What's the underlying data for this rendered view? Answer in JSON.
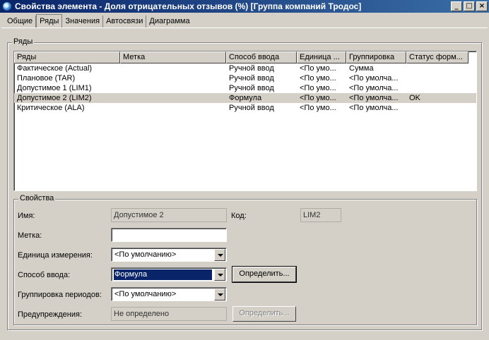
{
  "window": {
    "title": "Свойства элемента - Доля отрицательных отзывов (%) [Группа компаний Тродос]",
    "minimize": "_",
    "maximize": "□",
    "close": "×"
  },
  "tabs": [
    {
      "label": "Общие",
      "active": false
    },
    {
      "label": "Ряды",
      "active": true
    },
    {
      "label": "Значения",
      "active": false
    },
    {
      "label": "Автосвязи",
      "active": false
    },
    {
      "label": "Диаграмма",
      "active": false
    }
  ],
  "series_group": {
    "title": "Ряды",
    "columns": [
      "Ряды",
      "Метка",
      "Способ ввода",
      "Единица ...",
      "Группировка",
      "Статус форм..."
    ],
    "rows": [
      [
        "Фактическое (Actual)",
        "",
        "Ручной ввод",
        "<По умо...",
        "Сумма",
        ""
      ],
      [
        "Плановое (TAR)",
        "",
        "Ручной ввод",
        "<По умо...",
        "<По умолча...",
        ""
      ],
      [
        "Допустимое 1 (LIM1)",
        "",
        "Ручной ввод",
        "<По умо...",
        "<По умолча...",
        ""
      ],
      [
        "Допустимое 2 (LIM2)",
        "",
        "Формула",
        "<По умо...",
        "<По умолча...",
        "OK"
      ],
      [
        "Критическое (ALA)",
        "",
        "Ручной ввод",
        "<По умо...",
        "<По умолча...",
        ""
      ]
    ],
    "selected_row": 3
  },
  "properties": {
    "title": "Свойства",
    "name_label": "Имя:",
    "name_value": "Допустимое 2",
    "code_label": "Код:",
    "code_value": "LIM2",
    "tag_label": "Метка:",
    "tag_value": "",
    "unit_label": "Единица измерения:",
    "unit_value": "<По умолчанию>",
    "input_label": "Способ ввода:",
    "input_value": "Формула",
    "define_button": "Определить...",
    "grouping_label": "Группировка периодов:",
    "grouping_value": "<По умолчанию>",
    "warnings_label": "Предупреждения:",
    "warnings_value": "Не определено",
    "define_button_2": "Определить..."
  }
}
